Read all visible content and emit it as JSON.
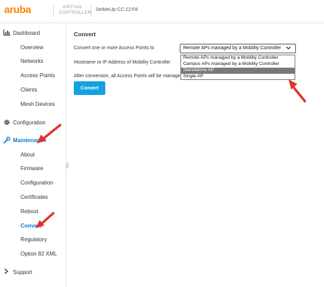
{
  "header": {
    "logo": "aruba",
    "product_line1": "VIRTUAL",
    "product_line2": "CONTROLLER",
    "device_name": "SetMeUp-CC:22:F8"
  },
  "sidebar": {
    "dashboard": {
      "label": "Dashboard",
      "items": [
        "Overview",
        "Networks",
        "Access Points",
        "Clients",
        "Mesh Devices"
      ]
    },
    "configuration": {
      "label": "Configuration"
    },
    "maintenance": {
      "label": "Maintenance",
      "items": [
        "About",
        "Firmware",
        "Configuration",
        "Certificates",
        "Reboot",
        "Convert",
        "Regulatory",
        "Option 82 XML"
      ]
    },
    "support": {
      "label": "Support"
    }
  },
  "main": {
    "title": "Convert",
    "convert_label": "Convert one or more Access Points to",
    "host_label": "Hostname or IP Address of Mobility Controller",
    "after_label": "After conversion, all Access Points will be managed",
    "selected_value": "Remote APs managed by a Mobility Controller",
    "options": [
      "Remote APs managed by a Mobility Controller",
      "Campus APs managed by a Mobility Controller",
      "Standalone AP",
      "Single AP"
    ],
    "highlighted_option_index": 2,
    "button_label": "Convert"
  },
  "colors": {
    "accent": "#0a78d1",
    "button": "#13a1e1",
    "logo": "#ff8300",
    "arrow": "#e0352b"
  }
}
